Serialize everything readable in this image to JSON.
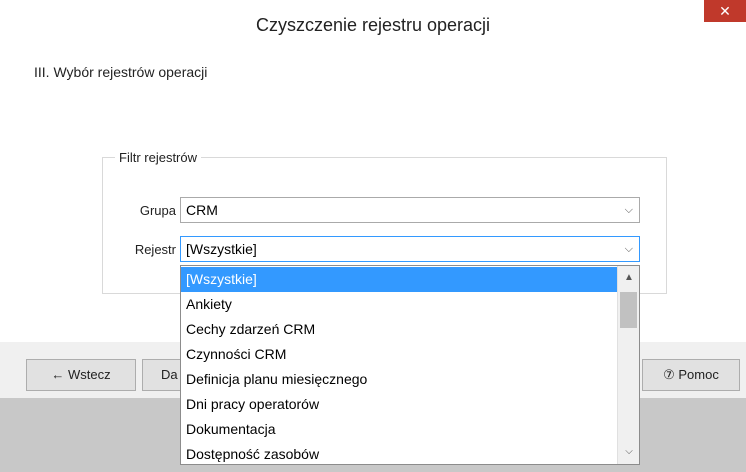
{
  "window": {
    "title": "Czyszczenie rejestru operacji",
    "close_label": "✕"
  },
  "section": {
    "title": "III. Wybór rejestrów operacji"
  },
  "filter": {
    "legend": "Filtr rejestrów",
    "group_label": "Grupa",
    "group_value": "CRM",
    "register_label": "Rejestr",
    "register_value": "[Wszystkie]"
  },
  "dropdown": {
    "items": [
      "[Wszystkie]",
      "Ankiety",
      "Cechy zdarzeń CRM",
      "Czynności CRM",
      "Definicja planu miesięcznego",
      "Dni pracy operatorów",
      "Dokumentacja",
      "Dostępność zasobów"
    ],
    "selected_index": 0
  },
  "buttons": {
    "back_label": "← Wstecz",
    "next_partial": "Da",
    "help_label": "⑦ Pomoc"
  },
  "colors": {
    "accent": "#3399ff",
    "close_bg": "#c0392b"
  }
}
